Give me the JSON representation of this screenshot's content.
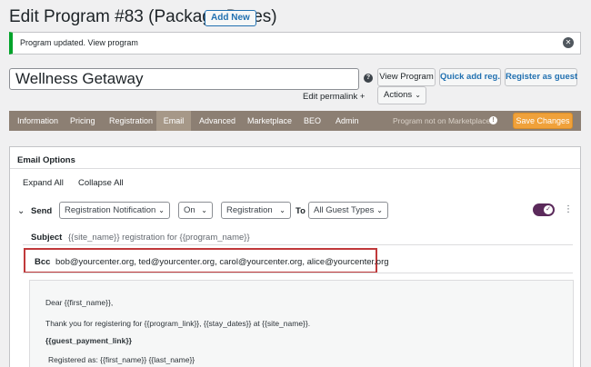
{
  "header": {
    "title": "Edit Program #83 (Package Dates)",
    "add_new_label": "Add New"
  },
  "notice": {
    "text": "Program updated. View program",
    "close_icon": "close-icon"
  },
  "program": {
    "title_value": "Wellness Getaway",
    "edit_permalink": "Edit permalink +",
    "help_glyph": "?"
  },
  "actions": {
    "view_program": "View Program",
    "quick_add": "Quick add reg.",
    "register_guest": "Register as guest",
    "actions_label": "Actions"
  },
  "tabs": {
    "items": [
      "Information",
      "Pricing",
      "Registration",
      "Email",
      "Advanced",
      "Marketplace",
      "BEO",
      "Admin"
    ],
    "active": "Email",
    "marketplace_note": "Program not on Marketplace",
    "save_label": "Save Changes"
  },
  "email_options": {
    "title": "Email Options",
    "expand_all": "Expand All",
    "collapse_all": "Collapse All",
    "send_label": "Send",
    "notification_select": "Registration Notification",
    "on_select": "On",
    "trigger_select": "Registration",
    "to_label": "To",
    "guest_select": "All Guest Types",
    "subject_label": "Subject",
    "subject_value": "{{site_name}} registration for {{program_name}}",
    "bcc_label": "Bcc",
    "bcc_value": "bob@yourcenter.org, ted@yourcenter.org, carol@yourcenter.org, alice@yourcenter.org",
    "body": {
      "greeting": "Dear {{first_name}},",
      "thanks": "Thank you for registering for {{program_link}}, {{stay_dates}} at {{site_name}}.",
      "payment_link": "{{guest_payment_link}}",
      "registered_as": "Registered as: {{first_name}} {{last_name}}"
    }
  },
  "colors": {
    "tab_bar": "#8c7f73",
    "save_button": "#f0a13a",
    "toggle_on": "#5b2a5b",
    "highlight_box": "#c0393b",
    "notice_border": "#00a32a"
  }
}
